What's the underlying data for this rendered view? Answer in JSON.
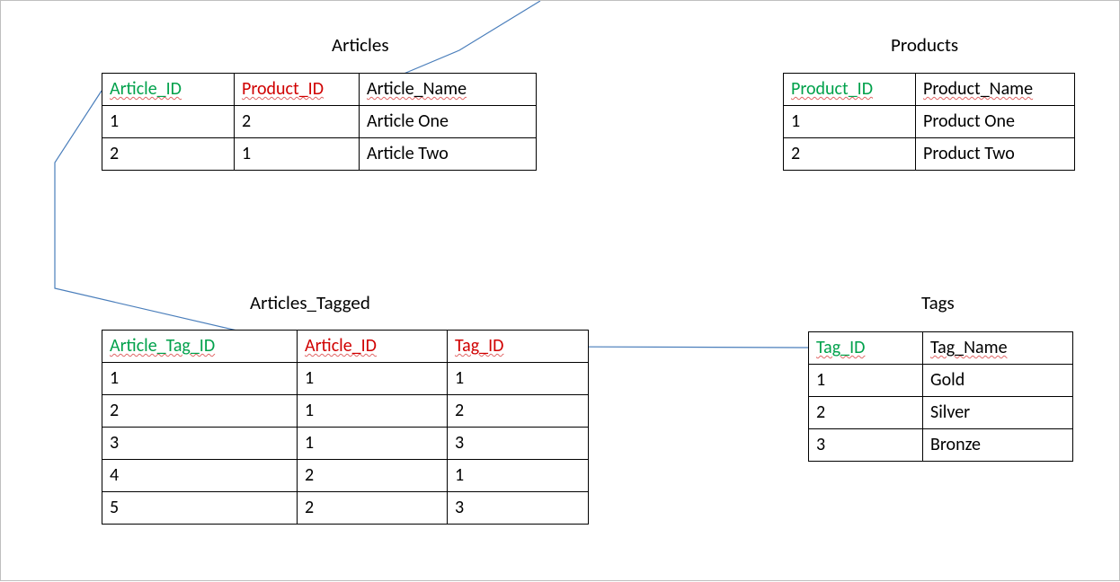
{
  "colors": {
    "pk": "#00a14b",
    "fk": "#d00000",
    "border": "#000000",
    "arrow": "#4a7ebb"
  },
  "titles": {
    "articles": "Articles",
    "products": "Products",
    "articles_tagged": "Articles_Tagged",
    "tags": "Tags"
  },
  "articles": {
    "columns": {
      "c0": "Article_ID",
      "c1": "Product_ID",
      "c2": "Article_Name"
    },
    "column_roles": {
      "c0": "pk",
      "c1": "fk",
      "c2": "plain"
    },
    "rows": [
      {
        "c0": "1",
        "c1": "2",
        "c2": "Article One"
      },
      {
        "c0": "2",
        "c1": "1",
        "c2": "Article Two"
      }
    ]
  },
  "products": {
    "columns": {
      "c0": "Product_ID",
      "c1": "Product_Name"
    },
    "column_roles": {
      "c0": "pk",
      "c1": "plain"
    },
    "rows": [
      {
        "c0": "1",
        "c1": "Product One"
      },
      {
        "c0": "2",
        "c1": "Product Two"
      }
    ]
  },
  "articles_tagged": {
    "columns": {
      "c0": "Article_Tag_ID",
      "c1": "Article_ID",
      "c2": "Tag_ID"
    },
    "column_roles": {
      "c0": "pk",
      "c1": "fk",
      "c2": "fk"
    },
    "rows": [
      {
        "c0": "1",
        "c1": "1",
        "c2": "1"
      },
      {
        "c0": "2",
        "c1": "1",
        "c2": "2"
      },
      {
        "c0": "3",
        "c1": "1",
        "c2": "3"
      },
      {
        "c0": "4",
        "c1": "2",
        "c2": "1"
      },
      {
        "c0": "5",
        "c1": "2",
        "c2": "3"
      }
    ]
  },
  "tags": {
    "columns": {
      "c0": "Tag_ID",
      "c1": "Tag_Name"
    },
    "column_roles": {
      "c0": "pk",
      "c1": "plain"
    },
    "rows": [
      {
        "c0": "1",
        "c1": "Gold"
      },
      {
        "c0": "2",
        "c1": "Silver"
      },
      {
        "c0": "3",
        "c1": "Bronze"
      }
    ]
  },
  "relationships": [
    {
      "from_table": "Articles",
      "from_column": "Product_ID",
      "to_table": "Products",
      "to_column": "Product_ID",
      "note": "arrow enters top-left region of diagram"
    },
    {
      "from_table": "Articles_Tagged",
      "from_column": "Article_ID",
      "to_table": "Articles",
      "to_column": "Article_ID"
    },
    {
      "from_table": "Articles_Tagged",
      "from_column": "Tag_ID",
      "to_table": "Tags",
      "to_column": "Tag_ID"
    }
  ]
}
